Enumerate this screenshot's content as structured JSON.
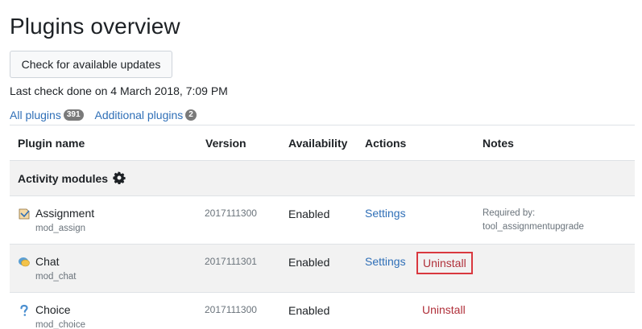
{
  "page": {
    "title": "Plugins overview",
    "check_button_label": "Check for available updates",
    "last_check": "Last check done on 4 March 2018, 7:09 PM"
  },
  "filters": [
    {
      "label": "All plugins",
      "count": "391"
    },
    {
      "label": "Additional plugins",
      "count": "2"
    }
  ],
  "table": {
    "headers": [
      "Plugin name",
      "Version",
      "Availability",
      "Actions",
      "Notes"
    ],
    "category": {
      "label": "Activity modules",
      "icon": "gear-icon"
    },
    "rows": [
      {
        "name": "Assignment",
        "component": "mod_assign",
        "version": "2017111300",
        "availability": "Enabled",
        "settings": "Settings",
        "uninstall": "",
        "notes_label": "Required by:",
        "notes_value": "tool_assignmentupgrade",
        "icon": "assignment-icon"
      },
      {
        "name": "Chat",
        "component": "mod_chat",
        "version": "2017111301",
        "availability": "Enabled",
        "settings": "Settings",
        "uninstall": "Uninstall",
        "notes_label": "",
        "notes_value": "",
        "icon": "chat-icon"
      },
      {
        "name": "Choice",
        "component": "mod_choice",
        "version": "2017111300",
        "availability": "Enabled",
        "settings": "",
        "uninstall": "Uninstall",
        "notes_label": "",
        "notes_value": "",
        "icon": "choice-icon"
      }
    ]
  },
  "colors": {
    "link": "#2f6fb7",
    "uninstall": "#b0303a",
    "highlight_border": "#d9383f"
  }
}
